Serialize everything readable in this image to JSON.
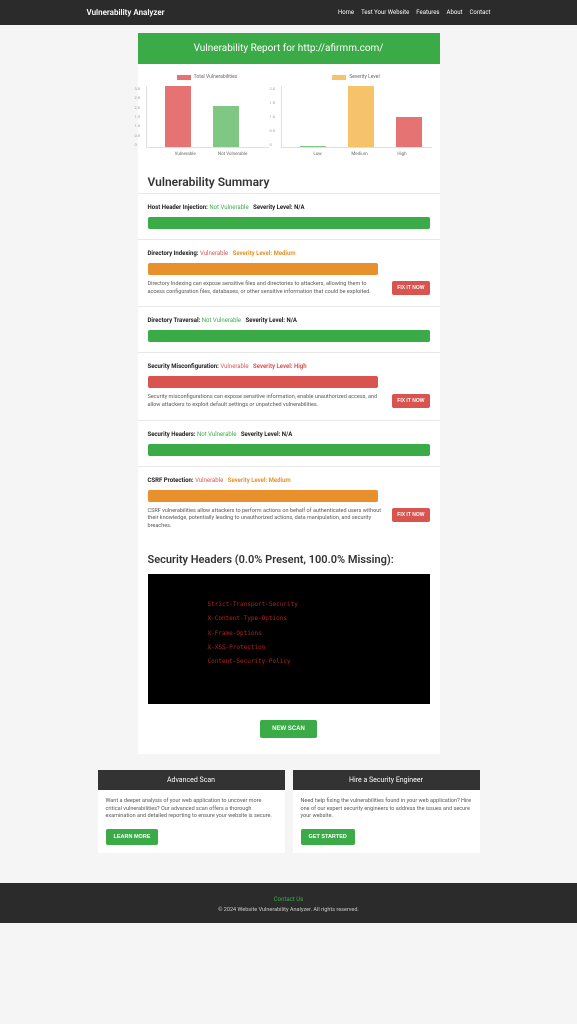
{
  "nav": {
    "brand": "Vulnerability Analyzer",
    "links": [
      "Home",
      "Test Your Website",
      "Features",
      "About",
      "Contact"
    ]
  },
  "report": {
    "title": "Vulnerability Report for http://afirmm.com/"
  },
  "chart_data": [
    {
      "type": "bar",
      "title": "Total Vulnerabilities",
      "categories": [
        "Vulnerable",
        "Not Vulnerable"
      ],
      "values": [
        3.0,
        2.0
      ],
      "colors": [
        "#e57373",
        "#81c784"
      ],
      "ylim": [
        0,
        3.0
      ],
      "yticks": [
        "3.0",
        "2.5",
        "2.0",
        "1.5",
        "1.0",
        "0.5",
        "0"
      ]
    },
    {
      "type": "bar",
      "title": "Severity Level",
      "categories": [
        "Low",
        "Medium",
        "High"
      ],
      "values": [
        0,
        2.0,
        1.0
      ],
      "colors": [
        "#81c784",
        "#f6c36b",
        "#e57373"
      ],
      "ylim": [
        0,
        2.0
      ],
      "yticks": [
        "2.0",
        "1.5",
        "1.0",
        "0.5",
        "0"
      ]
    }
  ],
  "summary_title": "Vulnerability Summary",
  "vulns": [
    {
      "name": "Host Header Injection:",
      "status": "Not Vulnerable",
      "status_class": "not-vuln",
      "sev_label": "Severity Level: N/A",
      "sev_class": "sev-na",
      "bar": "prog-green",
      "desc": "",
      "fix": false
    },
    {
      "name": "Directory Indexing:",
      "status": "Vulnerable",
      "status_class": "vuln",
      "sev_label": "Severity Level: Medium",
      "sev_class": "sev-med",
      "bar": "prog-orange",
      "desc": "Directory Indexing can expose sensitive files and directories to attackers, allowing them to access configuration files, databases, or other sensitive information that could be exploited.",
      "fix": true
    },
    {
      "name": "Directory Traversal:",
      "status": "Not Vulnerable",
      "status_class": "not-vuln",
      "sev_label": "Severity Level: N/A",
      "sev_class": "sev-na",
      "bar": "prog-green",
      "desc": "",
      "fix": false
    },
    {
      "name": "Security Misconfiguration:",
      "status": "Vulnerable",
      "status_class": "vuln",
      "sev_label": "Severity Level: High",
      "sev_class": "sev-high",
      "bar": "prog-red",
      "desc": "Security misconfigurations can expose sensitive information, enable unauthorized access, and allow attackers to exploit default settings or unpatched vulnerabilities.",
      "fix": true
    },
    {
      "name": "Security Headers:",
      "status": "Not Vulnerable",
      "status_class": "not-vuln",
      "sev_label": "Severity Level: N/A",
      "sev_class": "sev-na",
      "bar": "prog-green",
      "desc": "",
      "fix": false
    },
    {
      "name": "CSRF Protection:",
      "status": "Vulnerable",
      "status_class": "vuln",
      "sev_label": "Severity Level: Medium",
      "sev_class": "sev-med",
      "bar": "prog-orange",
      "desc": "CSRF vulnerabilities allow attackers to perform actions on behalf of authenticated users without their knowledge, potentially leading to unauthorized actions, data manipulation, and security breaches.",
      "fix": true
    }
  ],
  "fix_label": "FIX IT NOW",
  "headers_title": "Security Headers (0.0% Present, 100.0% Missing):",
  "headers_list": [
    "Strict-Transport-Security",
    "X-Content-Type-Options",
    "X-Frame-Options",
    "X-XSS-Protection",
    "Content-Security-Policy"
  ],
  "new_scan": "NEW SCAN",
  "promos": [
    {
      "title": "Advanced Scan",
      "body": "Want a deeper analysis of your web application to uncover more critical vulnerabilities? Our advanced scan offers a thorough examination and detailed reporting to ensure your website is secure.",
      "btn": "LEARN MORE"
    },
    {
      "title": "Hire a Security Engineer",
      "body": "Need help fixing the vulnerabilities found in your web application? Hire one of our expert security engineers to address the issues and secure your website.",
      "btn": "GET STARTED"
    }
  ],
  "footer": {
    "contact": "Contact Us",
    "copyright": "© 2024 Website Vulnerability Analyzer. All rights reserved."
  }
}
